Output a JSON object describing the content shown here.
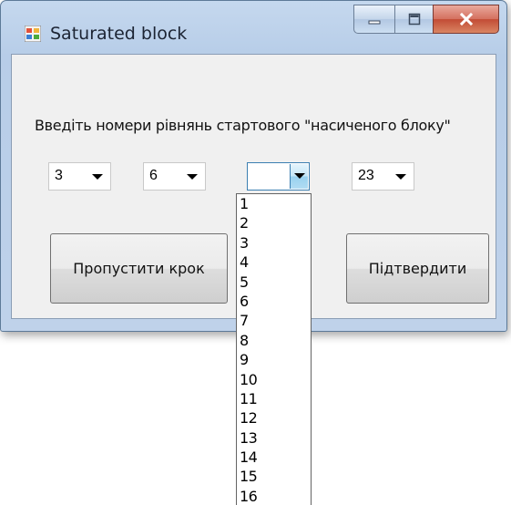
{
  "window": {
    "title": "Saturated block"
  },
  "form": {
    "prompt": "Введіть номери рівнянь стартового \"насиченого блоку\"",
    "combos": [
      {
        "value": "3"
      },
      {
        "value": "6"
      },
      {
        "value": ""
      },
      {
        "value": "23"
      }
    ],
    "skip_label": "Пропустити крок",
    "confirm_label": "Підтвердити"
  },
  "dropdown": {
    "items": [
      "1",
      "2",
      "3",
      "4",
      "5",
      "6",
      "7",
      "8",
      "9",
      "10",
      "11",
      "12",
      "13",
      "14",
      "15",
      "16"
    ]
  },
  "colors": {
    "close_button": "#c24b35",
    "combo_focus": "#3c7fb1",
    "titlebar": "#b7cde8"
  }
}
